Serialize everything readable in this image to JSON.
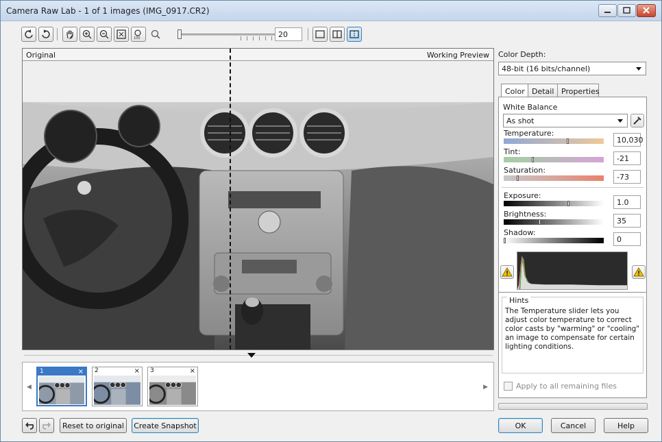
{
  "window": {
    "title": "Camera Raw Lab - 1 of 1 images (IMG_0917.CR2)"
  },
  "toolbar": {
    "zoom_value": "20",
    "icons": [
      "rotate-left-icon",
      "rotate-right-icon",
      "hand-icon",
      "zoom-in-icon",
      "zoom-out-icon",
      "fit-icon",
      "actual-size-icon",
      "zoom-icon",
      "single-view-icon",
      "split-view-icon",
      "split-view-alt-icon"
    ]
  },
  "preview": {
    "original_label": "Original",
    "working_label": "Working Preview"
  },
  "filmstrip": {
    "thumbnails": [
      {
        "number": "1",
        "close": "×"
      },
      {
        "number": "2",
        "close": "×"
      },
      {
        "number": "3",
        "close": "×"
      }
    ]
  },
  "bottom": {
    "reset_label": "Reset to original",
    "snapshot_label": "Create Snapshot"
  },
  "panel": {
    "color_depth_label": "Color Depth:",
    "color_depth_value": "48-bit (16 bits/channel)",
    "tabs": [
      "Color",
      "Detail",
      "Properties"
    ],
    "white_balance_label": "White Balance",
    "white_balance_value": "As shot",
    "temperature_label": "Temperature:",
    "temperature_value": "10,030",
    "tint_label": "Tint:",
    "tint_value": "-21",
    "saturation_label": "Saturation:",
    "saturation_value": "-73",
    "exposure_label": "Exposure:",
    "exposure_value": "1.0",
    "brightness_label": "Brightness:",
    "brightness_value": "35",
    "shadow_label": "Shadow:",
    "shadow_value": "0",
    "hints_title": "Hints",
    "hints_text": "The Temperature slider lets you adjust color temperature to correct color casts by \"warming\" or \"cooling\" an image to compensate for certain lighting conditions.",
    "apply_all_label": "Apply to all remaining files",
    "ok_label": "OK",
    "cancel_label": "Cancel",
    "help_label": "Help"
  },
  "colors": {
    "accent": "#3b78c6",
    "title_bg": "#c4d6ec"
  }
}
